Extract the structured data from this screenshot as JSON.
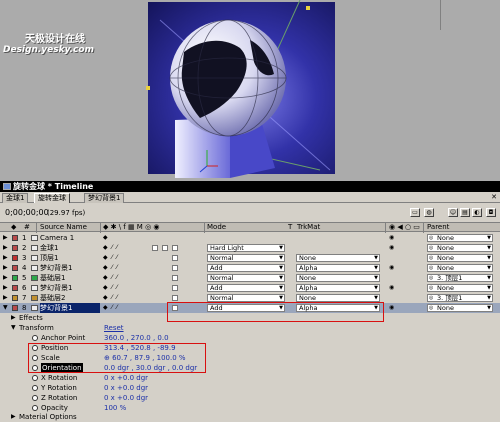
{
  "watermark": {
    "line1": "天极设计在线",
    "line2": "Design.yesky.com"
  },
  "timeline": {
    "title": "旋转金球 * Timeline",
    "tabs": [
      "金球1",
      "旋转金球",
      "梦幻背景1"
    ],
    "timecode": "0;00;00;00",
    "fps": "(29.97 fps)"
  },
  "columns": {
    "number": "#",
    "source_name": "Source Name",
    "switches": "◆ ✱ \\ f ▦ M ◎ ◉",
    "mode": "Mode",
    "t": "T",
    "trkmat": "TrkMat",
    "parent": "Parent"
  },
  "layers": [
    {
      "num": "1",
      "name": "Camera 1",
      "color": "#b94a4a",
      "mode": "",
      "trkmat": "",
      "parent": "None",
      "selected": false
    },
    {
      "num": "2",
      "name": "金球1",
      "color": "#b94a4a",
      "mode": "Hard Light",
      "trkmat": "",
      "parent": "None",
      "selected": false
    },
    {
      "num": "3",
      "name": "顶层1",
      "color": "#c03030",
      "mode": "Normal",
      "trkmat": "None",
      "parent": "None",
      "selected": false
    },
    {
      "num": "4",
      "name": "梦幻背景1",
      "color": "#b94a4a",
      "mode": "Add",
      "trkmat": "Alpha",
      "parent": "None",
      "selected": false
    },
    {
      "num": "5",
      "name": "基础层1",
      "color": "#2fa84a",
      "mode": "Normal",
      "trkmat": "None",
      "parent": "3. 顶层1",
      "selected": false
    },
    {
      "num": "6",
      "name": "梦幻背景1",
      "color": "#b94a4a",
      "mode": "Add",
      "trkmat": "Alpha",
      "parent": "None",
      "selected": false
    },
    {
      "num": "7",
      "name": "基础层2",
      "color": "#c09030",
      "mode": "Normal",
      "trkmat": "None",
      "parent": "3. 顶层1",
      "selected": false
    },
    {
      "num": "8",
      "name": "梦幻背景1",
      "color": "#b94a4a",
      "mode": "Add",
      "trkmat": "Alpha",
      "parent": "None",
      "selected": true
    }
  ],
  "properties": {
    "effects": "Effects",
    "transform": "Transform",
    "reset": "Reset",
    "items": [
      {
        "name": "Anchor Point",
        "value": "360.0 , 270.0 , 0.0"
      },
      {
        "name": "Position",
        "value": "313.4 , 520.8 , -89.9"
      },
      {
        "name": "Scale",
        "value": "⊕ 60.7 , 87.9 , 100.0 %"
      },
      {
        "name": "Orientation",
        "value": "0.0 dgr , 30.0 dgr , 0.0 dgr"
      },
      {
        "name": "X Rotation",
        "value": "0 x +0.0 dgr"
      },
      {
        "name": "Y Rotation",
        "value": "0 x +0.0 dgr"
      },
      {
        "name": "Z Rotation",
        "value": "0 x +0.0 dgr"
      },
      {
        "name": "Opacity",
        "value": "100 %"
      }
    ],
    "material_options": "Material Options"
  },
  "colors": {
    "highlight_box": "#d81010",
    "value_blue": "#1c30a8",
    "selected_row": "#0a246a"
  },
  "icons": [
    "timeline-icon",
    "stopwatch-icon",
    "camera-icon",
    "eye-icon",
    "speaker-icon",
    "pickwhip-icon",
    "dropdown-arrow-icon",
    "expand-arrow-icon"
  ]
}
